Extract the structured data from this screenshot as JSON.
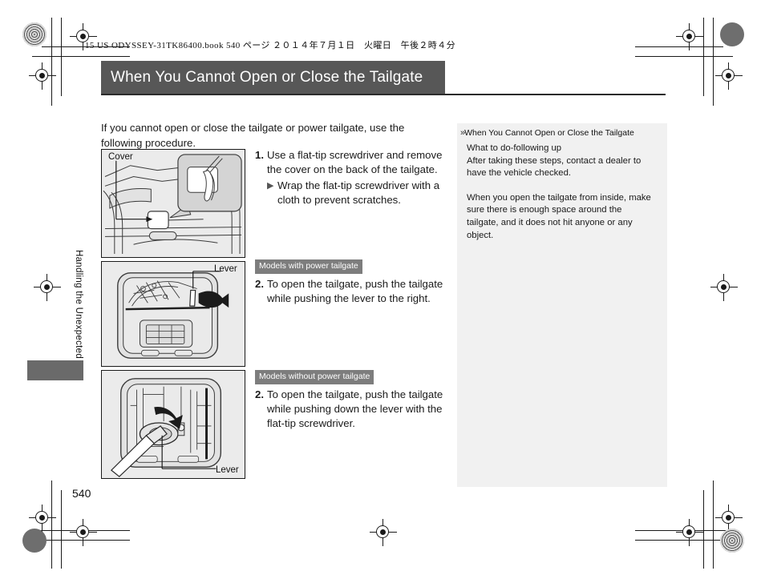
{
  "print_header": "15 US ODYSSEY-31TK86400.book  540 ページ  ２０１４年７月１日　火曜日　午後２時４分",
  "title": "When You Cannot Open or Close the Tailgate",
  "intro": "If you cannot open or close the tailgate or power tailgate, use the following procedure.",
  "chapter_tab": "Handling the Unexpected",
  "page_number": "540",
  "steps": [
    {
      "number": "1.",
      "text": "Use a flat-tip screwdriver and remove the cover on the back of the tailgate.",
      "substep_marker": "▶",
      "substep": "Wrap the flat-tip screwdriver with a cloth to prevent scratches."
    },
    {
      "badge": "Models with power tailgate",
      "number": "2.",
      "text": "To open the tailgate, push the tailgate while pushing the lever to the right."
    },
    {
      "badge": "Models without power tailgate",
      "number": "2.",
      "text": "To open the tailgate, push the tailgate while pushing down the lever with the flat-tip screwdriver."
    }
  ],
  "figures": [
    {
      "name": "tailgate-cover-illustration",
      "label": "Cover"
    },
    {
      "name": "power-tailgate-lever-illustration",
      "label": "Lever"
    },
    {
      "name": "manual-tailgate-lever-illustration",
      "label": "Lever"
    }
  ],
  "note": {
    "marker": "»",
    "title": "When You Cannot Open or Close the Tailgate",
    "paragraphs": [
      "What to do-following up",
      "After taking these steps, contact a dealer to have the vehicle checked.",
      "When you open the tailgate from inside, make sure there is enough space around the tailgate, and it does not hit anyone or any object."
    ]
  },
  "colors": {
    "title_bar": "#575757",
    "badge": "#7d7d7d",
    "note_panel": "#f1f1f1",
    "figure_bg": "#ebebeb",
    "thumb_tab": "#6a6a6a"
  }
}
